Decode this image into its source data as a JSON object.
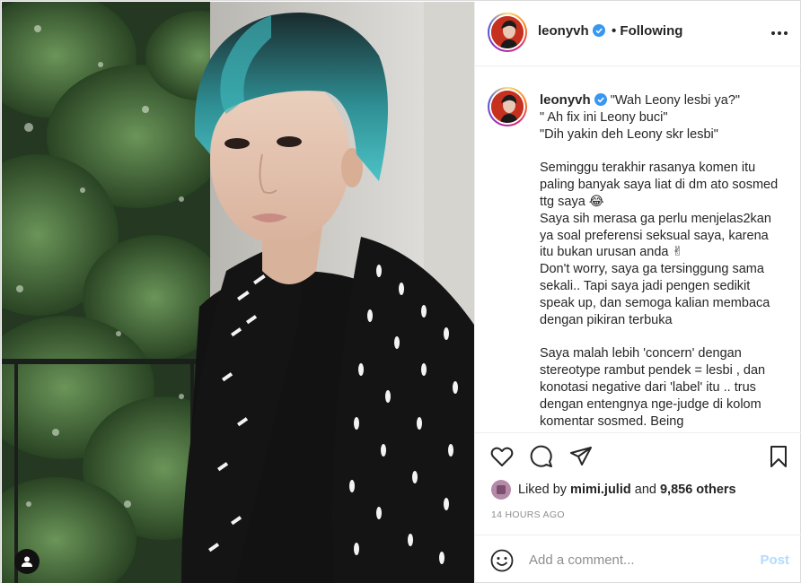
{
  "post": {
    "username": "leonyvh",
    "verified": true,
    "follow_status": "• Following",
    "caption_lines": [
      "\"Wah Leony lesbi ya?\"",
      "\" Ah fix ini Leony buci\"",
      "\"Dih yakin deh Leony skr lesbi\"",
      "",
      "Seminggu terakhir rasanya komen itu paling banyak saya liat di dm ato sosmed ttg saya 😂",
      "Saya sih merasa ga perlu menjelas2kan ya soal preferensi seksual saya, karena itu bukan urusan anda ✌",
      "Don't worry, saya ga tersinggung sama sekali.. Tapi saya jadi pengen sedikit speak up, dan semoga kalian membaca dengan pikiran terbuka",
      "",
      "Saya malah lebih 'concern' dengan stereotype rambut pendek = lesbi , dan konotasi negative dari 'label' itu .. trus dengan entengnya nge-judge di kolom komentar sosmed. Being"
    ],
    "liked_by_prefix": "Liked by",
    "liked_by_user": "mimi.julid",
    "liked_by_and": "and",
    "liked_by_others": "9,856 others",
    "timestamp": "14 HOURS AGO"
  },
  "comment": {
    "placeholder": "Add a comment...",
    "post_label": "Post"
  },
  "icons": {
    "verified": "verified-badge-icon",
    "more": "more-options-icon",
    "like": "heart-icon",
    "comment": "comment-icon",
    "share": "share-icon",
    "save": "bookmark-icon",
    "emoji": "emoji-icon",
    "user_tag": "user-tag-icon"
  },
  "colors": {
    "verified": "#3897f0",
    "post_disabled": "#b3dbff",
    "muted": "#8e8e8e"
  }
}
